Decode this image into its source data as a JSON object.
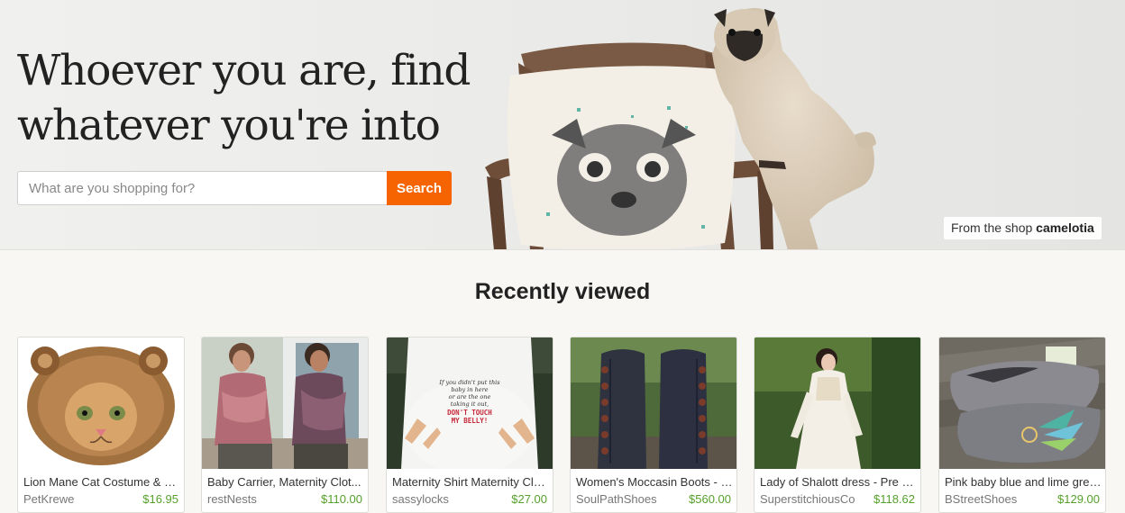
{
  "hero": {
    "title": "Whoever you are, find whatever you're into",
    "search": {
      "placeholder": "What are you shopping for?",
      "value": "",
      "button_label": "Search"
    },
    "credit_prefix": "From the shop ",
    "credit_shop": "camelotia"
  },
  "recently_viewed": {
    "heading": "Recently viewed",
    "items": [
      {
        "title": "Lion Mane Cat Costume & S...",
        "shop": "PetKrewe",
        "price": "$16.95",
        "image": "lion-mane-cat-photo"
      },
      {
        "title": "Baby Carrier, Maternity Clot...",
        "shop": "restNests",
        "price": "$110.00",
        "image": "baby-carrier-photo"
      },
      {
        "title": "Maternity Shirt Maternity Clo...",
        "shop": "sassylocks",
        "price": "$27.00",
        "image": "maternity-shirt-photo",
        "shirt_text": "If you didn't put this baby in here or are the one taking it out, DON'T TOUCH MY BELLY!"
      },
      {
        "title": "Women's Moccasin Boots - K...",
        "shop": "SoulPathShoes",
        "price": "$560.00",
        "image": "moccasin-boots-photo"
      },
      {
        "title": "Lady of Shalott dress - Pre R...",
        "shop": "SuperstitchiousCo",
        "price": "$118.62",
        "image": "shalott-dress-photo"
      },
      {
        "title": "Pink baby blue and lime gree...",
        "shop": "BStreetShoes",
        "price": "$129.00",
        "image": "painted-shoes-photo"
      }
    ]
  },
  "colors": {
    "accent": "#f56400",
    "price_green": "#56a02c",
    "page_bg": "#f8f7f3"
  }
}
